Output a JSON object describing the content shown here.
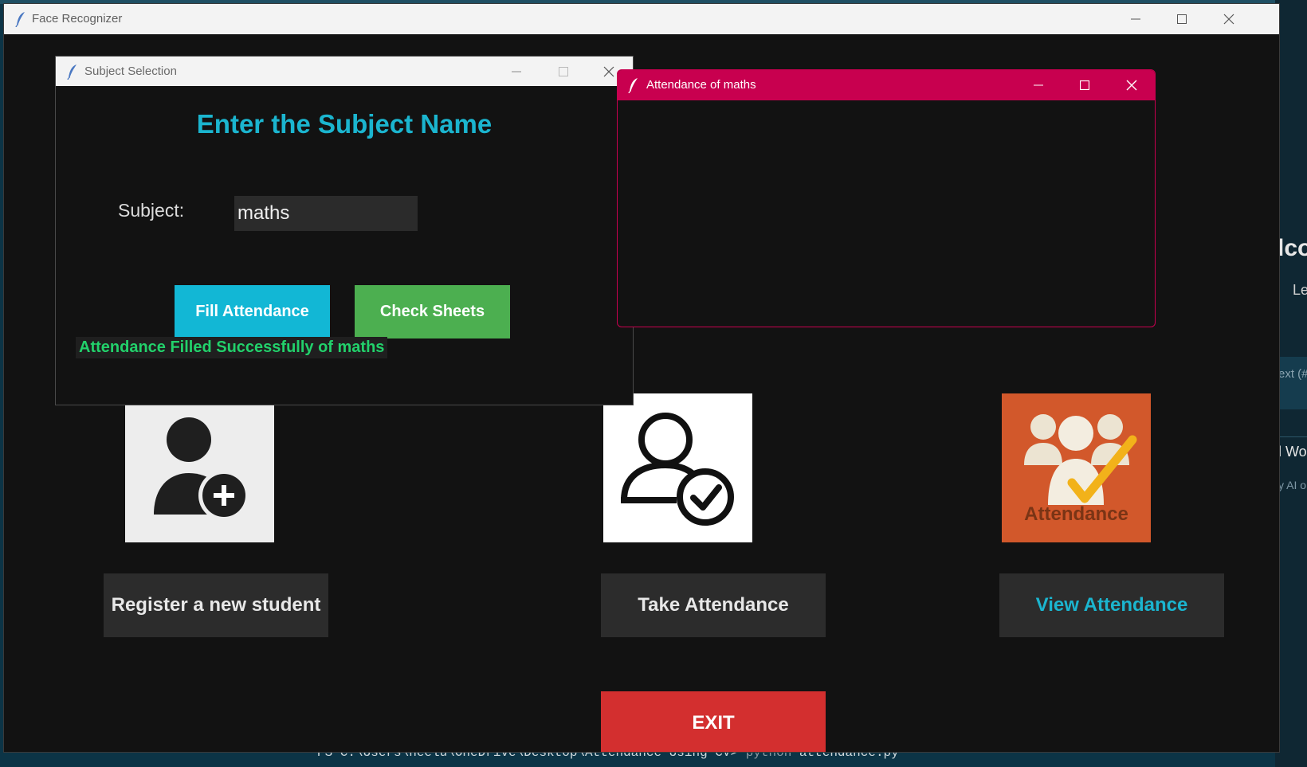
{
  "background": {
    "right_panel_title": "lco",
    "right_panel_sub": "Le",
    "right_panel_box_text": "ext (#",
    "right_panel_wor": "l Wor",
    "right_panel_ai": "y AI o",
    "terminal_prompt": "PS C:\\Users\\neelu\\OneDrive\\Desktop\\Attendance Using CV>",
    "terminal_cmd": "python",
    "terminal_arg": "attendance.py"
  },
  "main_window": {
    "title": "Face Recognizer",
    "buttons": {
      "register": "Register a new student",
      "take": "Take Attendance",
      "view": "View Attendance",
      "exit": "EXIT"
    },
    "attendance_tile_caption": "Attendance",
    "colors": {
      "view_label": "#1bb5cf",
      "exit": "#d32f2f",
      "attendance_tile": "#d2582b"
    }
  },
  "subject_dialog": {
    "title": "Subject Selection",
    "heading": "Enter the Subject Name",
    "subject_label": "Subject:",
    "subject_value": "maths",
    "fill_button": "Fill Attendance",
    "check_button": "Check Sheets",
    "status_message": "Attendance Filled Successfully of maths",
    "colors": {
      "heading": "#1bb5cf",
      "fill": "#12b7d5",
      "check": "#4caf50",
      "status": "#22d16b"
    }
  },
  "attendance_popup": {
    "title": "Attendance of maths",
    "colors": {
      "titlebar": "#c8004f"
    }
  },
  "icons": [
    "feather-icon",
    "minimize-icon",
    "maximize-icon",
    "close-icon",
    "add-user-icon",
    "user-check-icon",
    "attendance-group-icon"
  ]
}
